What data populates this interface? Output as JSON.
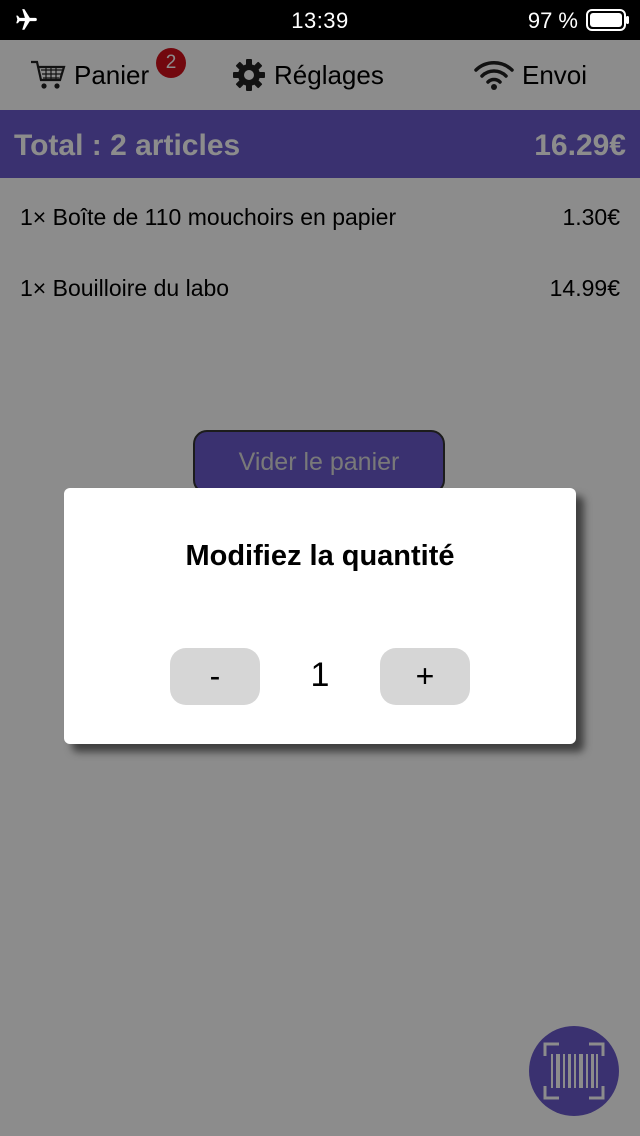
{
  "status_bar": {
    "time": "13:39",
    "battery": "97 %",
    "icons": [
      "airplane-icon",
      "battery-icon"
    ]
  },
  "tabs": {
    "cart_label": "Panier",
    "cart_badge": "2",
    "settings_label": "Réglages",
    "send_label": "Envoi",
    "icons": [
      "cart-icon",
      "gear-icon",
      "wifi-icon"
    ]
  },
  "cart": {
    "total_label": "Total : 2 articles",
    "total_amount": "16.29€",
    "items": [
      {
        "name": "1× Boîte de 110 mouchoirs en papier",
        "price": "1.30€"
      },
      {
        "name": "1× Bouilloire du labo",
        "price": "14.99€"
      }
    ],
    "clear_label": "Vider le panier"
  },
  "dialog": {
    "title": "Modifiez la quantité",
    "minus": "-",
    "quantity": "1",
    "plus": "+"
  },
  "scan_button": {
    "icon": "barcode-scan-icon"
  },
  "colors": {
    "accent": "#6a5acd",
    "badge": "#d0101a",
    "overlay": "rgba(0,0,0,0.45)",
    "stepper": "#d6d6d6"
  }
}
